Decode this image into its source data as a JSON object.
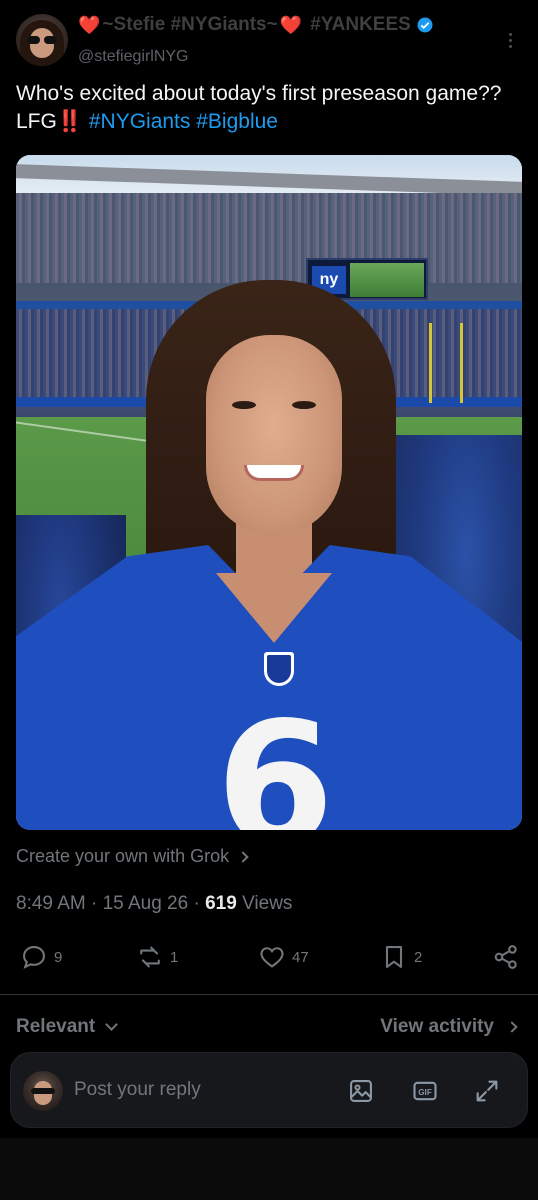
{
  "author": {
    "display_name_parts": [
      "~Stefie #NYGiants~",
      "#YANKEES"
    ],
    "heart_glyph": "❤️",
    "handle": "@stefiegirlNYG",
    "verified": true
  },
  "tweet": {
    "text_prefix": "Who's excited about today's first preseason game?? LFG",
    "emoji": "‼️",
    "hashtags": [
      "#NYGiants",
      "#Bigblue"
    ]
  },
  "photo": {
    "scoreboard_logo": "ny",
    "jersey_number": "6"
  },
  "grok_link": "Create your own with Grok",
  "meta": {
    "time": "8:49 AM",
    "sep1": "·",
    "date": "15 Aug 26",
    "sep2": "·",
    "views_count": "619",
    "views_label": "Views"
  },
  "actions": {
    "replies": "9",
    "reposts": "1",
    "likes": "47",
    "bookmarks": "2"
  },
  "sort": {
    "label": "Relevant",
    "view_activity": "View activity"
  },
  "reply_bar": {
    "placeholder": "Post your reply"
  },
  "icons": {
    "more": "more-icon",
    "reply": "reply-icon",
    "repost": "repost-icon",
    "like": "heart-icon",
    "bookmark": "bookmark-icon",
    "share": "share-icon",
    "image": "image-icon",
    "gif": "gif-icon",
    "expand": "expand-icon"
  },
  "colors": {
    "accent": "#1d9bf0",
    "background": "#000000",
    "muted": "#71767b",
    "heart": "#b3201d"
  }
}
